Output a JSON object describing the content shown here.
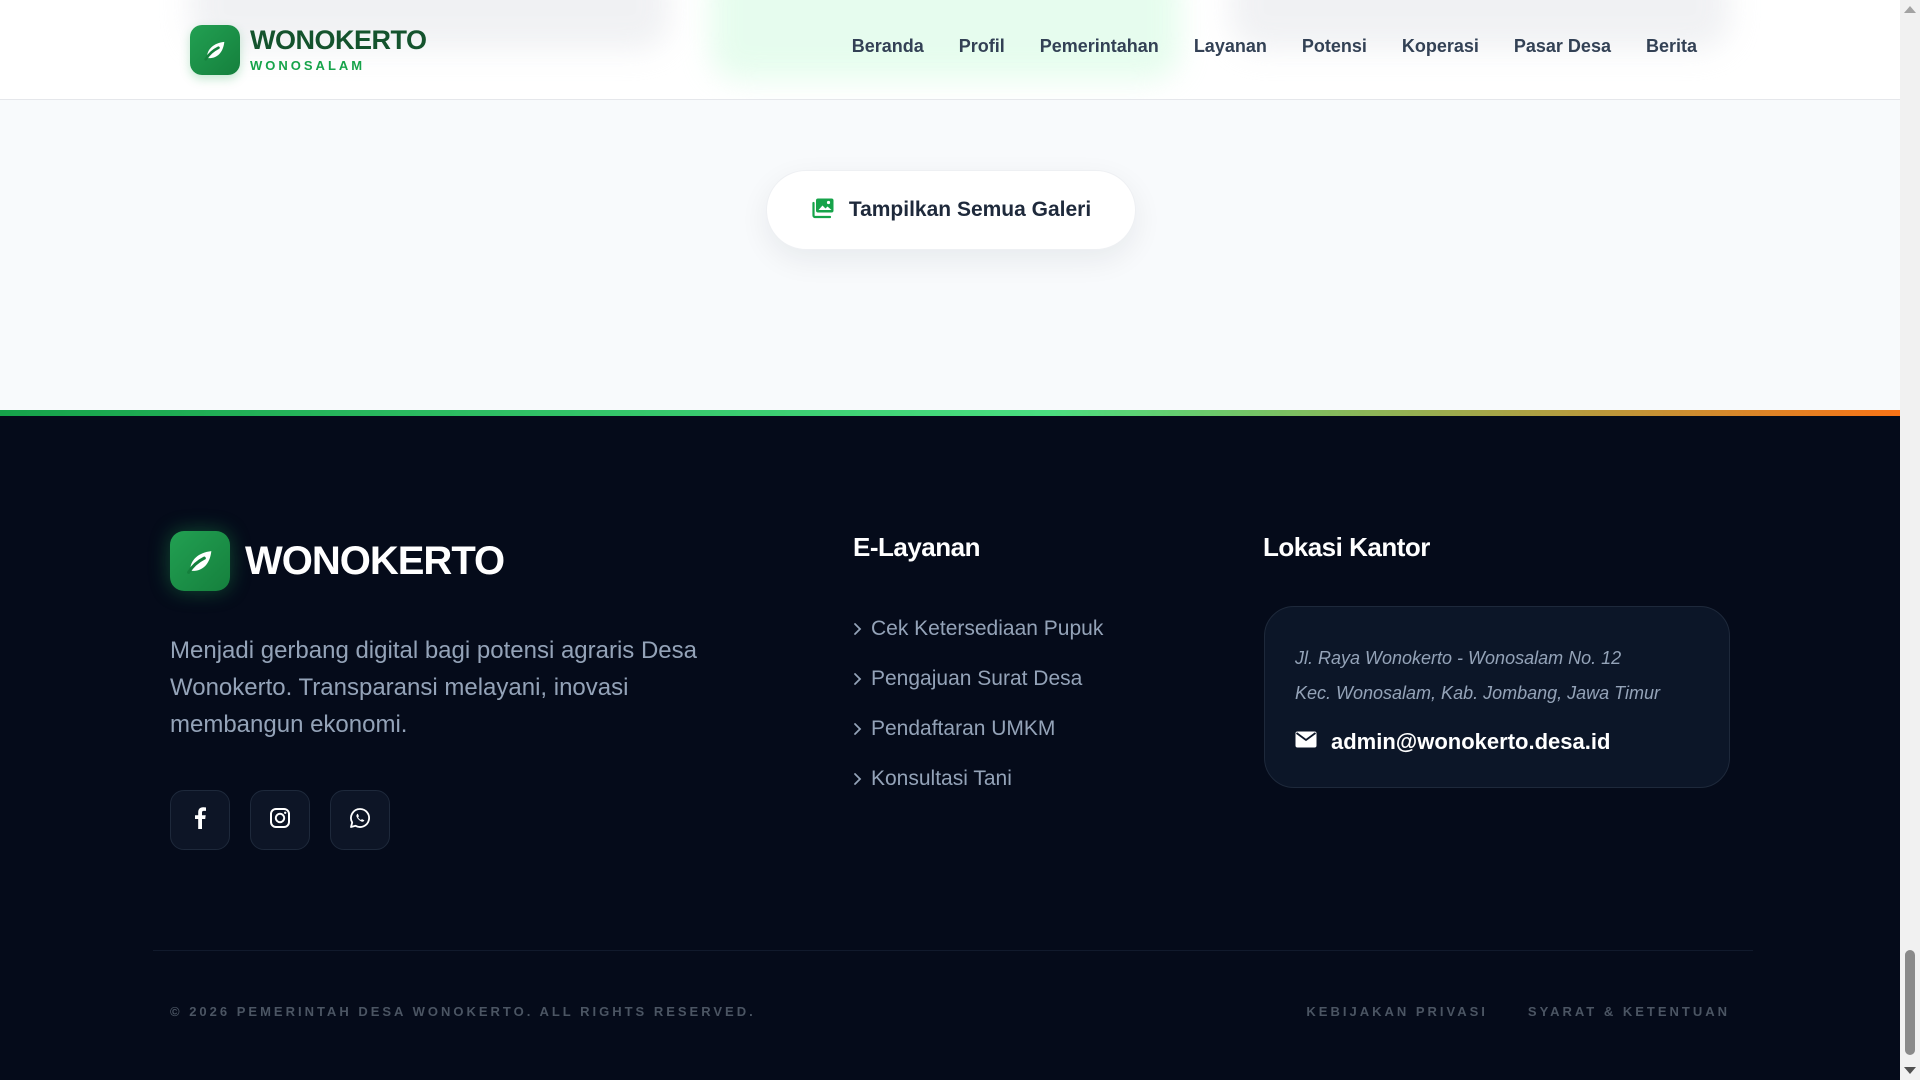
{
  "header": {
    "brand_name": "WONOKERTO",
    "brand_sub": "WONOSALAM",
    "nav": [
      "Beranda",
      "Profil",
      "Pemerintahan",
      "Layanan",
      "Potensi",
      "Koperasi",
      "Pasar Desa",
      "Berita"
    ]
  },
  "gallery": {
    "button_label": "Tampilkan Semua Galeri",
    "icon": "images-icon"
  },
  "footer": {
    "brand_name": "WONOKERTO",
    "description": "Menjadi gerbang digital bagi potensi agraris Desa Wonokerto. Transparansi melayani, inovasi membangun ekonomi.",
    "socials": [
      {
        "name": "facebook-icon"
      },
      {
        "name": "instagram-icon"
      },
      {
        "name": "whatsapp-icon"
      }
    ],
    "services_title": "E-Layanan",
    "services": [
      "Cek Ketersediaan Pupuk",
      "Pengajuan Surat Desa",
      "Pendaftaran UMKM",
      "Konsultasi Tani"
    ],
    "location_title": "Lokasi Kantor",
    "address_line1": "Jl. Raya Wonokerto - Wonosalam No. 12",
    "address_line2": "Kec. Wonosalam, Kab. Jombang, Jawa Timur",
    "email": "admin@wonokerto.desa.id",
    "copyright": "© 2026 PEMERINTAH DESA WONOKERTO. ALL RIGHTS RESERVED.",
    "legal": [
      "KEBIJAKAN PRIVASI",
      "SYARAT & KETENTUAN"
    ]
  },
  "colors": {
    "brand_green": "#16a34a",
    "dark_green": "#14532d",
    "footer_bg": "#050b1a",
    "accent_orange": "#f97316"
  }
}
